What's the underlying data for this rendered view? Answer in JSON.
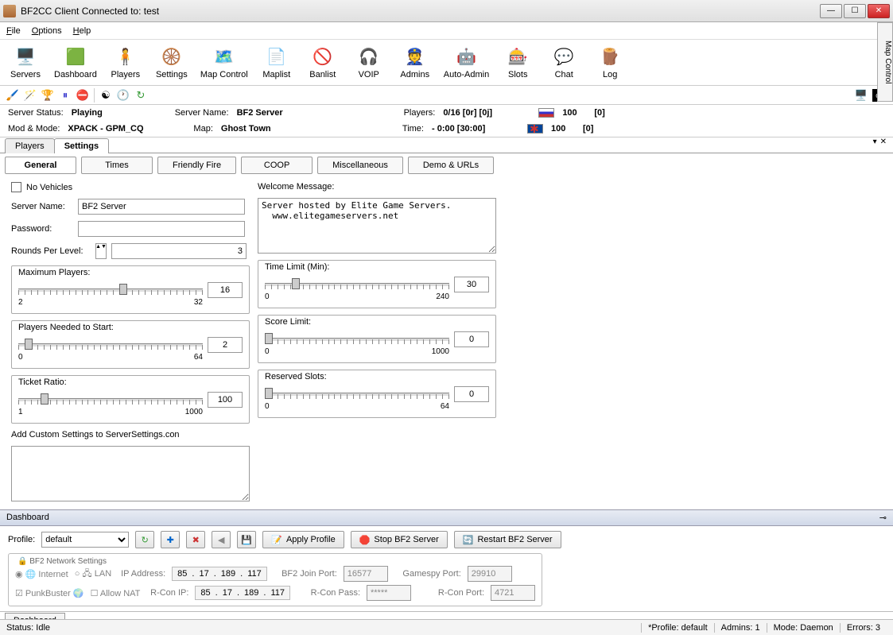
{
  "title": "BF2CC Client Connected to: test",
  "menu": {
    "file": "File",
    "options": "Options",
    "help": "Help"
  },
  "toolbar": [
    {
      "label": "Servers",
      "icon": "🖥️"
    },
    {
      "label": "Dashboard",
      "icon": "🟩"
    },
    {
      "label": "Players",
      "icon": "🧍"
    },
    {
      "label": "Settings",
      "icon": "🛞"
    },
    {
      "label": "Map Control",
      "icon": "🗺️"
    },
    {
      "label": "Maplist",
      "icon": "📄"
    },
    {
      "label": "Banlist",
      "icon": "🚫"
    },
    {
      "label": "VOIP",
      "icon": "🎧"
    },
    {
      "label": "Admins",
      "icon": "👮"
    },
    {
      "label": "Auto-Admin",
      "icon": "🤖"
    },
    {
      "label": "Slots",
      "icon": "🎰"
    },
    {
      "label": "Chat",
      "icon": "💬"
    },
    {
      "label": "Log",
      "icon": "🪵"
    }
  ],
  "status": {
    "server_status_label": "Server Status:",
    "server_status": "Playing",
    "server_name_label": "Server Name:",
    "server_name": "BF2 Server",
    "players_label": "Players:",
    "players": "0/16 [0r] [0j]",
    "mod_mode_label": "Mod & Mode:",
    "mod_mode": "XPACK - GPM_CQ",
    "map_label": "Map:",
    "map": "Ghost Town",
    "time_label": "Time:",
    "time": "- 0:00 [30:00]",
    "team1_score": "100",
    "team1_extra": "[0]",
    "team2_score": "100",
    "team2_extra": "[0]"
  },
  "tabs": {
    "players": "Players",
    "settings": "Settings"
  },
  "subtabs": {
    "general": "General",
    "times": "Times",
    "ff": "Friendly Fire",
    "coop": "COOP",
    "misc": "Miscellaneous",
    "demo": "Demo & URLs"
  },
  "settings": {
    "no_vehicles": "No Vehicles",
    "server_name_label": "Server Name:",
    "server_name": "BF2 Server",
    "password_label": "Password:",
    "password": "",
    "rounds_label": "Rounds Per Level:",
    "rounds": "3",
    "welcome_label": "Welcome Message:",
    "welcome": "Server hosted by Elite Game Servers.\n  www.elitegameservers.net",
    "max_players": {
      "label": "Maximum Players:",
      "min": "2",
      "max": "32",
      "value": "16",
      "thumb": 45
    },
    "players_needed": {
      "label": "Players Needed to Start:",
      "min": "0",
      "max": "64",
      "value": "2",
      "thumb": 3
    },
    "ticket_ratio": {
      "label": "Ticket Ratio:",
      "min": "1",
      "max": "1000",
      "value": "100",
      "thumb": 10
    },
    "time_limit": {
      "label": "Time Limit (Min):",
      "min": "0",
      "max": "240",
      "value": "30",
      "thumb": 12
    },
    "score_limit": {
      "label": "Score Limit:",
      "min": "0",
      "max": "1000",
      "value": "0",
      "thumb": 0
    },
    "reserved_slots": {
      "label": "Reserved Slots:",
      "min": "0",
      "max": "64",
      "value": "0",
      "thumb": 0
    },
    "custom_label": "Add Custom Settings to ServerSettings.con"
  },
  "dashboard": {
    "header": "Dashboard",
    "profile_label": "Profile:",
    "profile": "default",
    "apply": "Apply Profile",
    "stop": "Stop BF2 Server",
    "restart": "Restart BF2 Server",
    "network_legend": "BF2 Network Settings",
    "internet": "Internet",
    "lan": "LAN",
    "punkbuster": "PunkBuster",
    "allow_nat": "Allow NAT",
    "ip_label": "IP Address:",
    "ip": [
      "85",
      "17",
      "189",
      "117"
    ],
    "rcon_ip_label": "R-Con IP:",
    "rcon_ip": [
      "85",
      "17",
      "189",
      "117"
    ],
    "join_port_label": "BF2 Join Port:",
    "join_port": "16577",
    "gamespy_label": "Gamespy Port:",
    "gamespy": "29910",
    "rcon_pass_label": "R-Con Pass:",
    "rcon_pass": "*****",
    "rcon_port_label": "R-Con Port:",
    "rcon_port": "4721",
    "tab": "Dashboard"
  },
  "statusbar": {
    "status": "Status: Idle",
    "profile": "*Profile: default",
    "admins": "Admins: 1",
    "mode": "Mode: Daemon",
    "errors": "Errors: 3"
  },
  "sidepanel": "Map Control"
}
